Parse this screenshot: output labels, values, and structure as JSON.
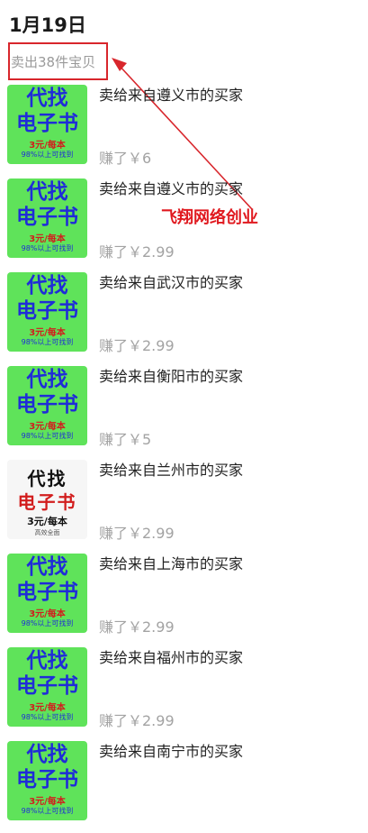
{
  "date": "1月19日",
  "sold_summary": "卖出38件宝贝",
  "annotation": "飞翔网络创业",
  "orders": [
    {
      "thumb_style": "green",
      "thumb_lines": [
        "代找",
        "电子书",
        "3元/每本",
        "98%以上可找到"
      ],
      "title": "卖给来自遵义市的买家",
      "earned": "赚了￥6"
    },
    {
      "thumb_style": "green",
      "thumb_lines": [
        "代找",
        "电子书",
        "3元/每本",
        "98%以上可找到"
      ],
      "title": "卖给来自遵义市的买家",
      "earned": "赚了￥2.99"
    },
    {
      "thumb_style": "green",
      "thumb_lines": [
        "代找",
        "电子书",
        "3元/每本",
        "98%以上可找到"
      ],
      "title": "卖给来自武汉市的买家",
      "earned": "赚了￥2.99"
    },
    {
      "thumb_style": "green",
      "thumb_lines": [
        "代找",
        "电子书",
        "3元/每本",
        "98%以上可找到"
      ],
      "title": "卖给来自衡阳市的买家",
      "earned": "赚了￥5"
    },
    {
      "thumb_style": "white",
      "thumb_lines": [
        "代找",
        "电子书",
        "3元/每本",
        "高效全面"
      ],
      "title": "卖给来自兰州市的买家",
      "earned": "赚了￥2.99"
    },
    {
      "thumb_style": "green",
      "thumb_lines": [
        "代找",
        "电子书",
        "3元/每本",
        "98%以上可找到"
      ],
      "title": "卖给来自上海市的买家",
      "earned": "赚了￥2.99"
    },
    {
      "thumb_style": "green",
      "thumb_lines": [
        "代找",
        "电子书",
        "3元/每本",
        "98%以上可找到"
      ],
      "title": "卖给来自福州市的买家",
      "earned": "赚了￥2.99"
    },
    {
      "thumb_style": "green",
      "thumb_lines": [
        "代找",
        "电子书",
        "3元/每本",
        "98%以上可找到"
      ],
      "title": "卖给来自南宁市的买家",
      "earned": ""
    }
  ],
  "colors": {
    "highlight": "#d8262c",
    "thumb_green": "#5fe35a",
    "thumb_text": "#1f2cd8"
  }
}
